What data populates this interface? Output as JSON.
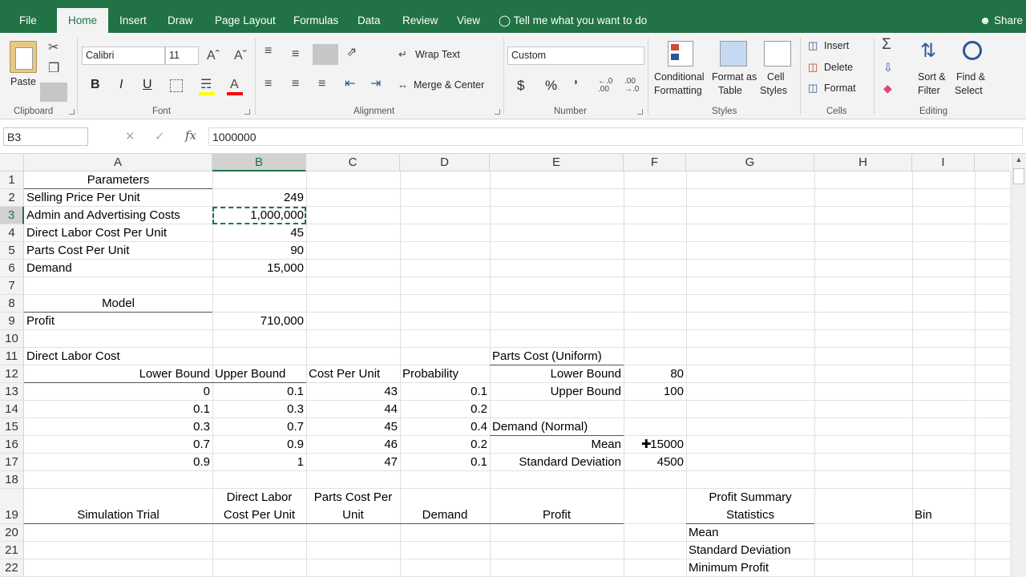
{
  "tabs": [
    "File",
    "Home",
    "Insert",
    "Draw",
    "Page Layout",
    "Formulas",
    "Data",
    "Review",
    "View"
  ],
  "tell_me": "Tell me what you want to do",
  "share": "Share",
  "ribbon": {
    "paste": "Paste",
    "clipboard": "Clipboard",
    "font_name": "Calibri",
    "font_size": "11",
    "font_group": "Font",
    "bold": "B",
    "italic": "I",
    "underline": "U",
    "wrap_text": "Wrap Text",
    "merge_center": "Merge & Center",
    "alignment": "Alignment",
    "number_format": "Custom",
    "number": "Number",
    "currency": "$",
    "percent": "%",
    "comma": "’",
    "conditional_1": "Conditional",
    "conditional_2": "Formatting",
    "format_as_1": "Format as",
    "format_as_2": "Table",
    "cell_styles_1": "Cell",
    "cell_styles_2": "Styles",
    "styles": "Styles",
    "insert": "Insert",
    "delete": "Delete",
    "format": "Format",
    "cells": "Cells",
    "sort_1": "Sort &",
    "sort_2": "Filter",
    "find_1": "Find &",
    "find_2": "Select",
    "editing": "Editing"
  },
  "formula_bar": {
    "name_box": "B3",
    "fx": "fx",
    "cancel": "✕",
    "enter": "✓",
    "value": "1000000"
  },
  "columns": [
    "A",
    "B",
    "C",
    "D",
    "E",
    "F",
    "G",
    "H",
    "I"
  ],
  "rows": [
    "1",
    "2",
    "3",
    "4",
    "5",
    "6",
    "7",
    "8",
    "9",
    "10",
    "11",
    "12",
    "13",
    "14",
    "15",
    "16",
    "17",
    "18",
    "19",
    "20",
    "21",
    "22"
  ],
  "cells": {
    "A1": "Parameters",
    "A2": "Selling Price Per Unit",
    "B2": "249",
    "A3": "Admin and Advertising Costs",
    "B3": "1,000,000",
    "A4": "Direct Labor Cost Per Unit",
    "B4": "45",
    "A5": "Parts Cost Per Unit",
    "B5": "90",
    "A6": "Demand",
    "B6": "15,000",
    "A8": "Model",
    "A9": "Profit",
    "B9": "710,000",
    "A11": "Direct Labor Cost",
    "E11": "Parts Cost (Uniform)",
    "A12": "Lower Bound",
    "B12": "Upper Bound",
    "C12": "Cost Per Unit",
    "D12": "Probability",
    "E12": "Lower Bound",
    "F12": "80",
    "A13": "0",
    "B13": "0.1",
    "C13": "43",
    "D13": "0.1",
    "E13": "Upper Bound",
    "F13": "100",
    "A14": "0.1",
    "B14": "0.3",
    "C14": "44",
    "D14": "0.2",
    "A15": "0.3",
    "B15": "0.7",
    "C15": "45",
    "D15": "0.4",
    "E15": "Demand (Normal)",
    "A16": "0.7",
    "B16": "0.9",
    "C16": "46",
    "D16": "0.2",
    "E16": "Mean",
    "F16": "15000",
    "A17": "0.9",
    "B17": "1",
    "C17": "47",
    "D17": "0.1",
    "E17": "Standard Deviation",
    "F17": "4500",
    "B19a": "Direct Labor",
    "B19b": "Cost Per Unit",
    "C19a": "Parts Cost Per",
    "C19b": "Unit",
    "A19": "Simulation Trial",
    "D19": "Demand",
    "E19": "Profit",
    "G19a": "Profit Summary",
    "G19b": "Statistics",
    "I19": "Bin",
    "G20": "Mean",
    "G21": "Standard Deviation",
    "G22": "Minimum Profit"
  },
  "colors": {
    "accent": "#217346",
    "selection": "#e1e1e1"
  }
}
